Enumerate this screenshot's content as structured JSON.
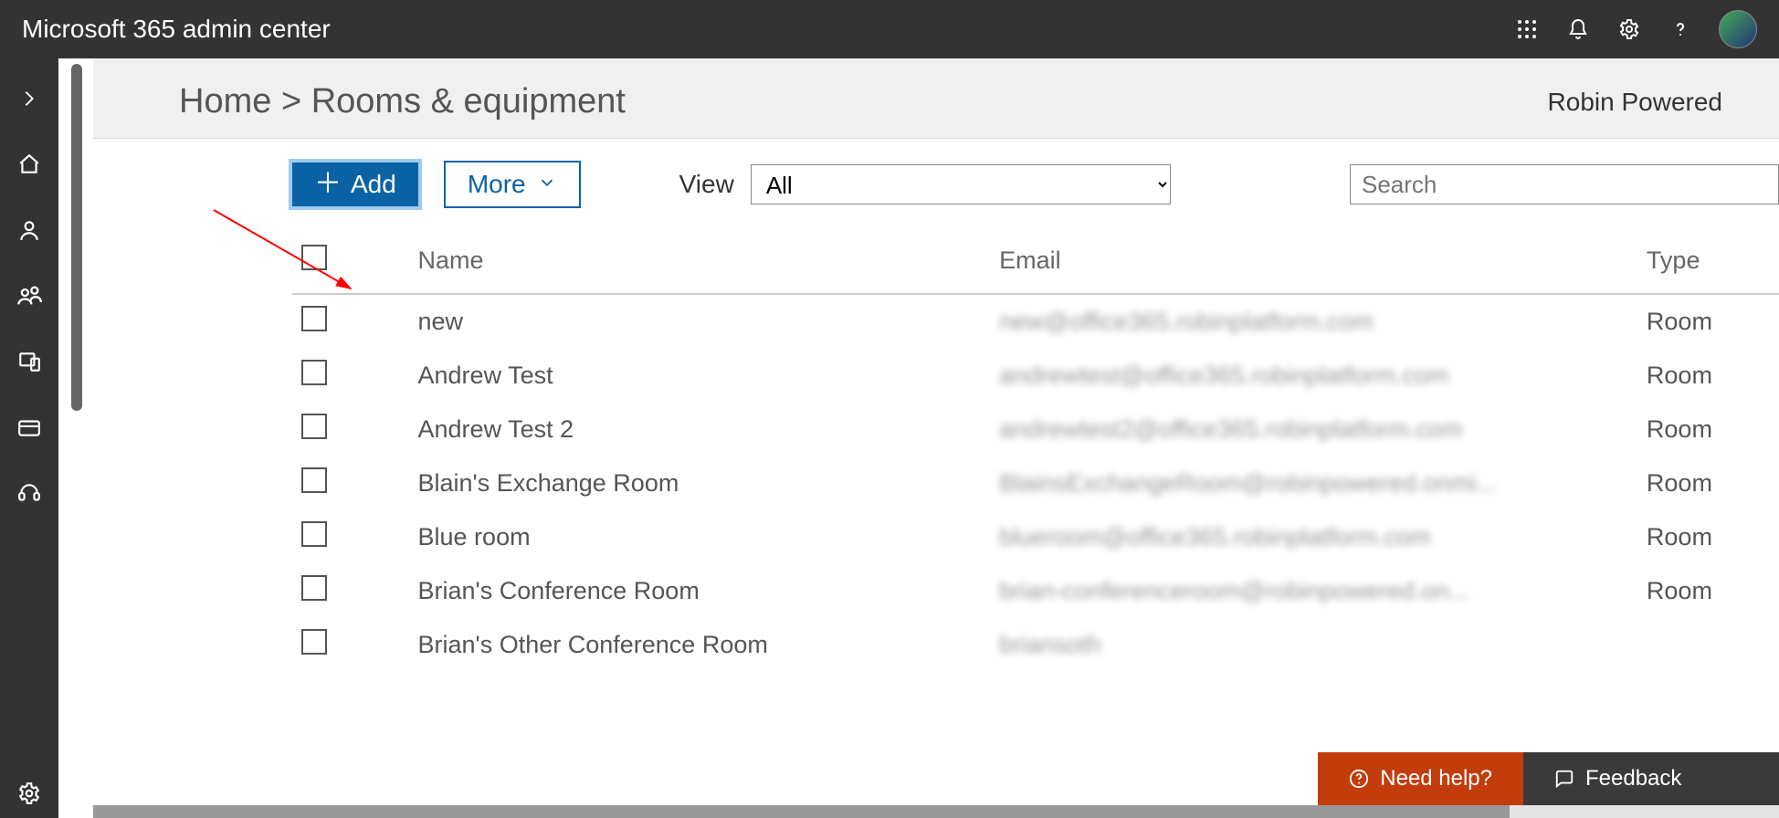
{
  "header": {
    "title": "Microsoft 365 admin center"
  },
  "breadcrumb": {
    "home": "Home",
    "separator": ">",
    "current": "Rooms & equipment"
  },
  "org": "Robin Powered",
  "toolbar": {
    "add_label": "Add",
    "more_label": "More",
    "view_label": "View",
    "view_value": "All",
    "search_placeholder": "Search"
  },
  "columns": {
    "name": "Name",
    "email": "Email",
    "type": "Type"
  },
  "rows": [
    {
      "name": "new",
      "email": "new@office365.robinplatform.com",
      "type": "Room"
    },
    {
      "name": "Andrew Test",
      "email": "andrewtest@office365.robinplatform.com",
      "type": "Room"
    },
    {
      "name": "Andrew Test 2",
      "email": "andrewtest2@office365.robinplatform.com",
      "type": "Room"
    },
    {
      "name": "Blain's Exchange Room",
      "email": "BlainsExchangeRoom@robinpowered.onmi...",
      "type": "Room"
    },
    {
      "name": "Blue room",
      "email": "blueroom@office365.robinplatform.com",
      "type": "Room"
    },
    {
      "name": "Brian's Conference Room",
      "email": "brian-conferenceroom@robinpowered.on...",
      "type": "Room"
    },
    {
      "name": "Brian's Other Conference Room",
      "email": "briansoth",
      "type": ""
    }
  ],
  "footer": {
    "need_help": "Need help?",
    "feedback": "Feedback"
  }
}
